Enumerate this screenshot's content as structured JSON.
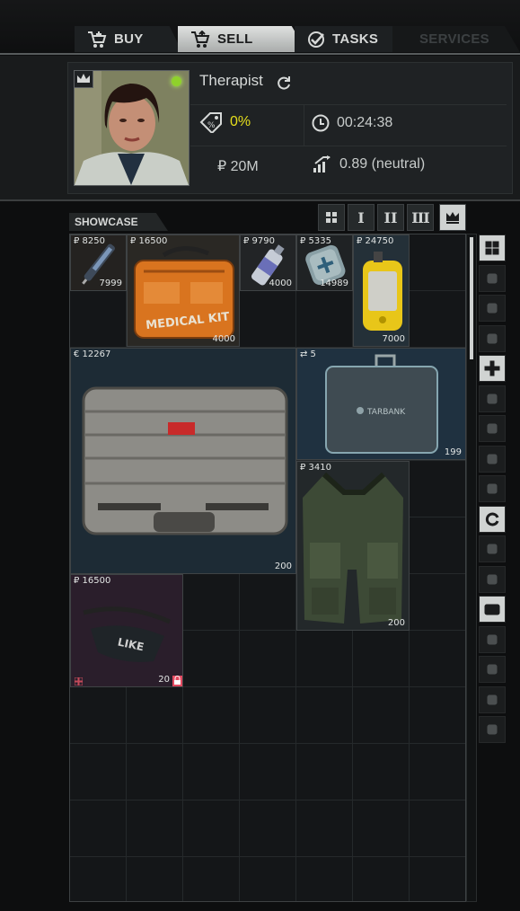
{
  "tabs": [
    {
      "label": "BUY"
    },
    {
      "label": "SELL"
    },
    {
      "label": "TASKS"
    },
    {
      "label": "SERVICES"
    }
  ],
  "trader": {
    "name": "Therapist",
    "discount": "0%",
    "timer": "00:24:38",
    "money": "₽ 20M",
    "standing": "0.89 (neutral)",
    "status_color": "#8fd12b"
  },
  "showcase": {
    "label": "SHOWCASE",
    "filters": [
      {
        "label": ""
      },
      {
        "label": "I"
      },
      {
        "label": "II"
      },
      {
        "label": "III"
      },
      {
        "label": ""
      }
    ],
    "items": [
      {
        "price": "₽ 8250",
        "count": "7999"
      },
      {
        "price": "₽ 16500",
        "count": "4000",
        "caption": "MEDICAL KIT"
      },
      {
        "price": "₽ 9790",
        "count": "4000"
      },
      {
        "price": "₽ 5335",
        "count": "14989"
      },
      {
        "price": "₽ 24750",
        "count": "7000"
      },
      {
        "price": "€ 12267",
        "count": "200"
      },
      {
        "price": "⇄ 5",
        "count": "199",
        "caption": "TARBANK"
      },
      {
        "price": "₽ 3410",
        "count": "200"
      },
      {
        "price": "₽ 16500",
        "count": "20",
        "caption": "LIKE"
      }
    ]
  },
  "categories": [
    "grid-icon",
    "rifle-icon",
    "magazine-icon",
    "ammo-icon",
    "medical-icon",
    "provisions-icon",
    "knife-icon",
    "barter-icon",
    "grenade-icon",
    "refresh-icon",
    "gear-icon",
    "map-icon",
    "container-icon",
    "key-icon",
    "book-icon",
    "keys-icon",
    "info-icon"
  ],
  "colors": {
    "accent": "#cfd2d1",
    "discount": "#e6df1c",
    "background": "#0d0e0f"
  }
}
